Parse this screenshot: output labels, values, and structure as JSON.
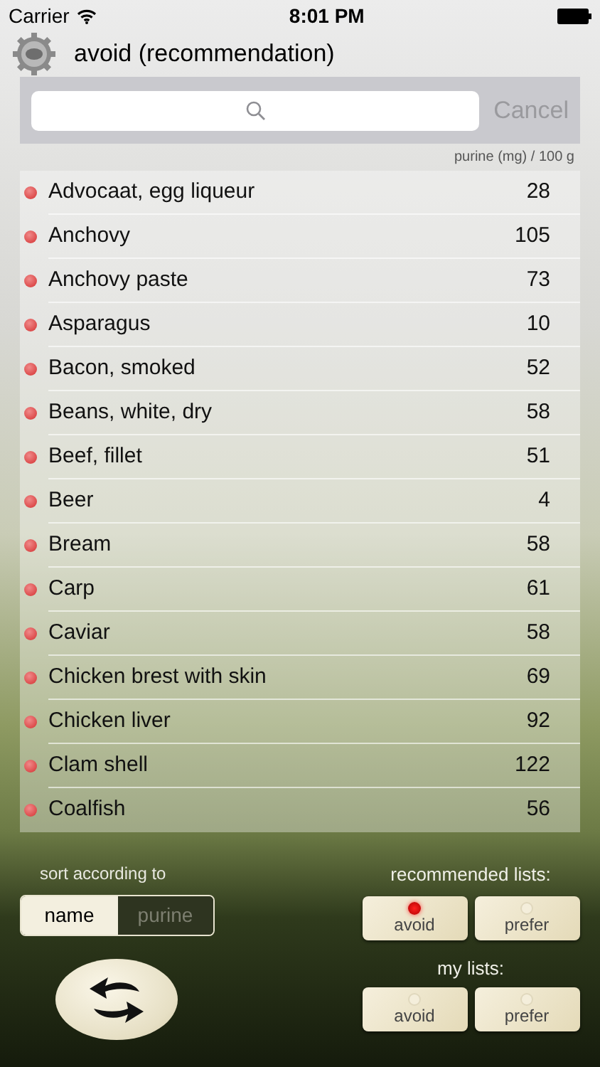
{
  "status_bar": {
    "carrier": "Carrier",
    "time": "8:01 PM"
  },
  "header": {
    "title": "avoid (recommendation)"
  },
  "search": {
    "cancel": "Cancel"
  },
  "column_caption": "purine (mg) / 100 g",
  "foods": [
    {
      "name": "Advocaat, egg liqueur",
      "purine": "28"
    },
    {
      "name": "Anchovy",
      "purine": "105"
    },
    {
      "name": "Anchovy paste",
      "purine": "73"
    },
    {
      "name": "Asparagus",
      "purine": "10"
    },
    {
      "name": "Bacon, smoked",
      "purine": "52"
    },
    {
      "name": "Beans, white, dry",
      "purine": "58"
    },
    {
      "name": "Beef, fillet",
      "purine": "51"
    },
    {
      "name": "Beer",
      "purine": "4"
    },
    {
      "name": "Bream",
      "purine": "58"
    },
    {
      "name": "Carp",
      "purine": "61"
    },
    {
      "name": "Caviar",
      "purine": "58"
    },
    {
      "name": "Chicken brest with skin",
      "purine": "69"
    },
    {
      "name": "Chicken liver",
      "purine": "92"
    },
    {
      "name": "Clam shell",
      "purine": "122"
    },
    {
      "name": "Coalfish",
      "purine": "56"
    }
  ],
  "sort": {
    "label": "sort according to",
    "options": [
      {
        "label": "name",
        "selected": true
      },
      {
        "label": "purine",
        "selected": false
      }
    ]
  },
  "recommended_lists": {
    "label": "recommended lists:",
    "options": [
      {
        "label": "avoid",
        "selected": true
      },
      {
        "label": "prefer",
        "selected": false
      }
    ]
  },
  "my_lists": {
    "label": "my lists:",
    "options": [
      {
        "label": "avoid",
        "selected": false
      },
      {
        "label": "prefer",
        "selected": false
      }
    ]
  }
}
